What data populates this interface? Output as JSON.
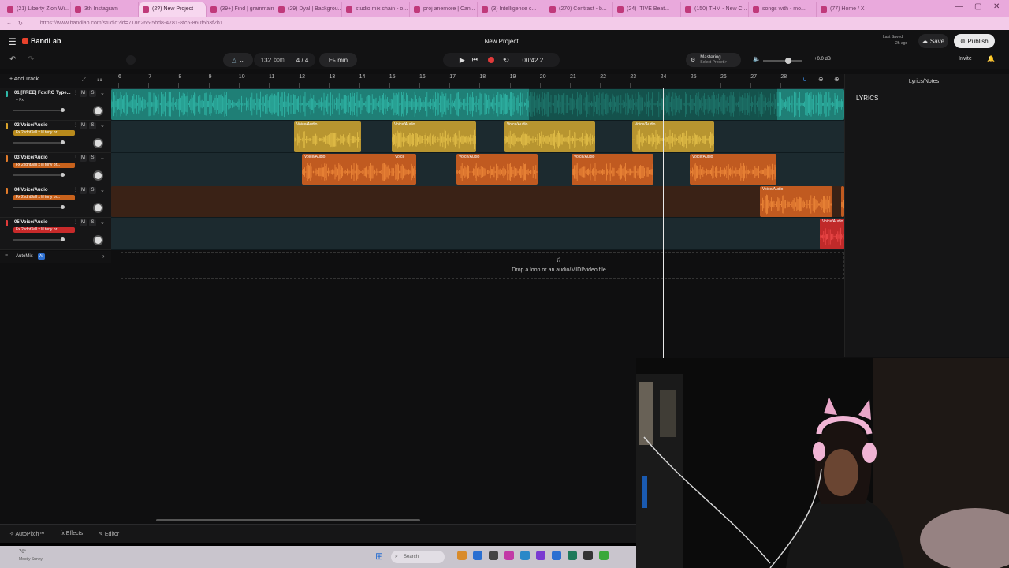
{
  "browser": {
    "tabs": [
      {
        "label": "(21) Liberty Zion Wi..."
      },
      {
        "label": "3th Instagram"
      },
      {
        "label": "(2?) New Project",
        "active": true
      },
      {
        "label": "(39+) Find | grainmain"
      },
      {
        "label": "(29) Dyal | Backgrou..."
      },
      {
        "label": "studio mix chain - o..."
      },
      {
        "label": "proj anemore | Can..."
      },
      {
        "label": "(3) Intelligence c..."
      },
      {
        "label": "(270) Contrast - b..."
      },
      {
        "label": "(24) ITIVE Beat..."
      },
      {
        "label": "(150) THM - New C..."
      },
      {
        "label": "songs with - mo..."
      },
      {
        "label": "(77) Home / X"
      }
    ],
    "url": "https://www.bandlab.com/studio?id=7186265-5bd8-4781-8fc5-860f5b3f2b1"
  },
  "app": {
    "brand": "BandLab",
    "project_title": "New Project",
    "last_saved_label": "Last Saved",
    "last_saved_value": "2h ago",
    "save_label": "Save",
    "publish_label": "Publish",
    "invite_label": "Invite",
    "bpm_value": "132",
    "bpm_unit": "bpm",
    "time_signature": "4 / 4",
    "key_value": "E♭ min",
    "time_display": "00:42.2",
    "mastering_label": "Mastering",
    "mastering_sub": "Select Preset >",
    "volume_db": "+0.0 dB",
    "add_track_label": "Add Track",
    "automix_label": "AutoMix",
    "automix_badge": "AI",
    "drop_hint": "Drop a loop or an audio/MIDI/video file",
    "lyrics_panel_title": "Lyrics/Notes",
    "lyrics_heading": "LYRICS",
    "bottom": {
      "autopitch": "AutoPitch™",
      "effects": "Effects",
      "editor": "Editor"
    },
    "accent_color": "#2fb8a8"
  },
  "ruler_ticks": [
    "6",
    "7",
    "8",
    "9",
    "10",
    "11",
    "12",
    "13",
    "14",
    "15",
    "16",
    "17",
    "18",
    "19",
    "20",
    "21",
    "22",
    "23",
    "24",
    "25",
    "26",
    "27",
    "28"
  ],
  "tracks": [
    {
      "name": "01 [FREE] Fox RO Type...",
      "fx": "+ Fx",
      "color": "#2fb8a8",
      "fx_color": "transparent"
    },
    {
      "name": "02 Voice/Audio",
      "fx": "Fx 2xdnt3all x lil tony pr...",
      "color": "#d8a22a",
      "fx_color": "#b88a1c"
    },
    {
      "name": "03 Voice/Audio",
      "fx": "Fx 2xdnt3all x lil tony pr...",
      "color": "#e07a2a",
      "fx_color": "#c8621c"
    },
    {
      "name": "04 Voice/Audio",
      "fx": "Fx 2xdnt3all x lil tony pr...",
      "color": "#e07a2a",
      "fx_color": "#c8621c"
    },
    {
      "name": "05 Voice/Audio",
      "fx": "Fx 2xdnt3all x lil tony pr...",
      "color": "#e03a3a",
      "fx_color": "#c82a2a"
    }
  ],
  "clip_label": "Voice/Audio",
  "clip_label_short": "Voice",
  "mute_label": "M",
  "solo_label": "S",
  "taskbar": {
    "search_placeholder": "Search"
  },
  "system_tray": {
    "weather": "70°",
    "weather_desc": "Mostly Sunny"
  }
}
